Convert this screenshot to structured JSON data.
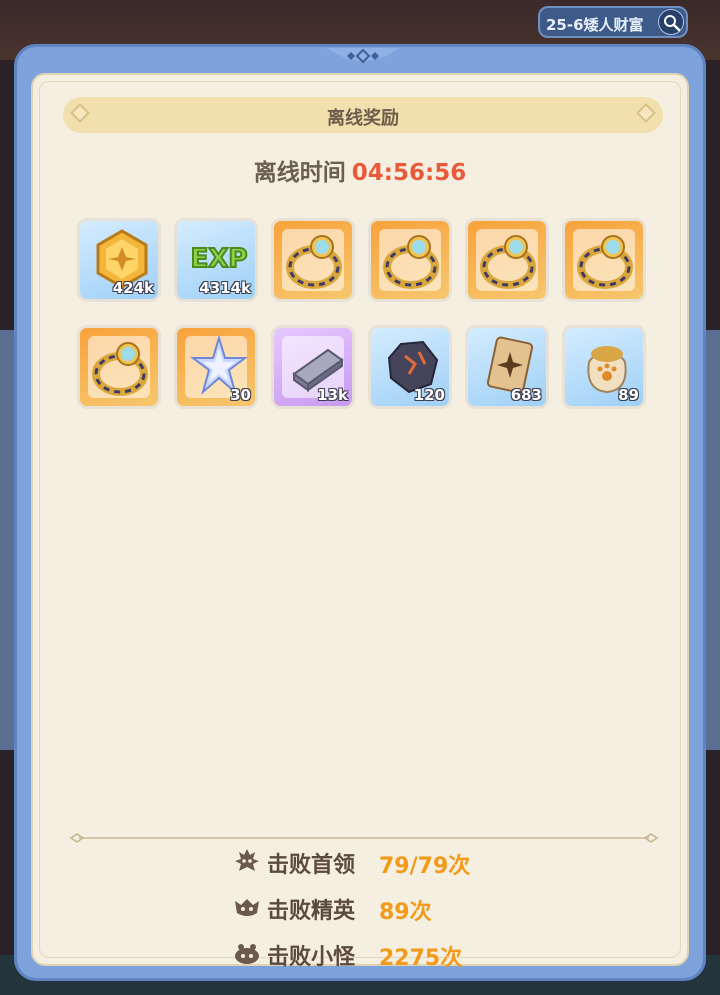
{
  "stage": {
    "label": "25-6矮人财富"
  },
  "dialog": {
    "title": "离线奖励",
    "offline_label": "离线时间",
    "offline_time": "04:56:56"
  },
  "rewards": [
    {
      "icon": "gold-coin-icon",
      "rarity": "blue",
      "quantity": "424k"
    },
    {
      "icon": "exp-icon",
      "rarity": "blue",
      "quantity": "4314k"
    },
    {
      "icon": "ring-icon",
      "rarity": "orange",
      "quantity": ""
    },
    {
      "icon": "ring-icon",
      "rarity": "orange",
      "quantity": ""
    },
    {
      "icon": "ring-icon",
      "rarity": "orange",
      "quantity": ""
    },
    {
      "icon": "ring-icon",
      "rarity": "orange",
      "quantity": ""
    },
    {
      "icon": "ring-icon",
      "rarity": "orange",
      "quantity": ""
    },
    {
      "icon": "crystal-star-icon",
      "rarity": "orange",
      "quantity": "30"
    },
    {
      "icon": "iron-ingot-icon",
      "rarity": "purple",
      "quantity": "13k"
    },
    {
      "icon": "ore-icon",
      "rarity": "blue",
      "quantity": "120"
    },
    {
      "icon": "card-icon",
      "rarity": "blue",
      "quantity": "683"
    },
    {
      "icon": "pouch-icon",
      "rarity": "blue",
      "quantity": "89"
    }
  ],
  "stats": [
    {
      "icon": "boss-icon",
      "label": "击败首领",
      "value": "79/79次"
    },
    {
      "icon": "elite-icon",
      "label": "击败精英",
      "value": "89次"
    },
    {
      "icon": "minion-icon",
      "label": "击败小怪",
      "value": "2275次"
    }
  ],
  "colors": {
    "accent": "#e85b3a",
    "stat_value": "#f29a19",
    "panel": "#7ea2dc"
  }
}
